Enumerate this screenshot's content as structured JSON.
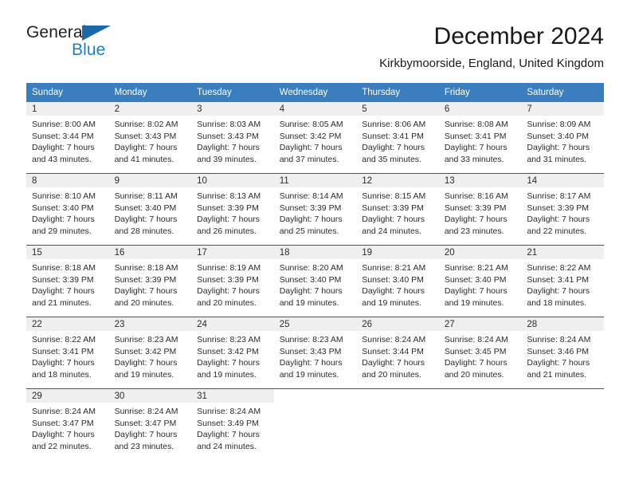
{
  "brand": {
    "name_part1": "General",
    "name_part2": "Blue",
    "flag_icon": "triangle-flag-icon"
  },
  "header": {
    "month_title": "December 2024",
    "location": "Kirkbymoorside, England, United Kingdom"
  },
  "colors": {
    "header_blue": "#3a7ebf",
    "separator_blue": "#1f5fa0",
    "daynum_band": "#efefef",
    "brand_blue": "#1f7ec4",
    "brand_flag": "#1769aa",
    "text": "#2b2b2b"
  },
  "weekday_headers": [
    "Sunday",
    "Monday",
    "Tuesday",
    "Wednesday",
    "Thursday",
    "Friday",
    "Saturday"
  ],
  "weeks": [
    [
      {
        "day": "1",
        "sunrise": "Sunrise: 8:00 AM",
        "sunset": "Sunset: 3:44 PM",
        "daylight_line1": "Daylight: 7 hours",
        "daylight_line2": "and 43 minutes."
      },
      {
        "day": "2",
        "sunrise": "Sunrise: 8:02 AM",
        "sunset": "Sunset: 3:43 PM",
        "daylight_line1": "Daylight: 7 hours",
        "daylight_line2": "and 41 minutes."
      },
      {
        "day": "3",
        "sunrise": "Sunrise: 8:03 AM",
        "sunset": "Sunset: 3:43 PM",
        "daylight_line1": "Daylight: 7 hours",
        "daylight_line2": "and 39 minutes."
      },
      {
        "day": "4",
        "sunrise": "Sunrise: 8:05 AM",
        "sunset": "Sunset: 3:42 PM",
        "daylight_line1": "Daylight: 7 hours",
        "daylight_line2": "and 37 minutes."
      },
      {
        "day": "5",
        "sunrise": "Sunrise: 8:06 AM",
        "sunset": "Sunset: 3:41 PM",
        "daylight_line1": "Daylight: 7 hours",
        "daylight_line2": "and 35 minutes."
      },
      {
        "day": "6",
        "sunrise": "Sunrise: 8:08 AM",
        "sunset": "Sunset: 3:41 PM",
        "daylight_line1": "Daylight: 7 hours",
        "daylight_line2": "and 33 minutes."
      },
      {
        "day": "7",
        "sunrise": "Sunrise: 8:09 AM",
        "sunset": "Sunset: 3:40 PM",
        "daylight_line1": "Daylight: 7 hours",
        "daylight_line2": "and 31 minutes."
      }
    ],
    [
      {
        "day": "8",
        "sunrise": "Sunrise: 8:10 AM",
        "sunset": "Sunset: 3:40 PM",
        "daylight_line1": "Daylight: 7 hours",
        "daylight_line2": "and 29 minutes."
      },
      {
        "day": "9",
        "sunrise": "Sunrise: 8:11 AM",
        "sunset": "Sunset: 3:40 PM",
        "daylight_line1": "Daylight: 7 hours",
        "daylight_line2": "and 28 minutes."
      },
      {
        "day": "10",
        "sunrise": "Sunrise: 8:13 AM",
        "sunset": "Sunset: 3:39 PM",
        "daylight_line1": "Daylight: 7 hours",
        "daylight_line2": "and 26 minutes."
      },
      {
        "day": "11",
        "sunrise": "Sunrise: 8:14 AM",
        "sunset": "Sunset: 3:39 PM",
        "daylight_line1": "Daylight: 7 hours",
        "daylight_line2": "and 25 minutes."
      },
      {
        "day": "12",
        "sunrise": "Sunrise: 8:15 AM",
        "sunset": "Sunset: 3:39 PM",
        "daylight_line1": "Daylight: 7 hours",
        "daylight_line2": "and 24 minutes."
      },
      {
        "day": "13",
        "sunrise": "Sunrise: 8:16 AM",
        "sunset": "Sunset: 3:39 PM",
        "daylight_line1": "Daylight: 7 hours",
        "daylight_line2": "and 23 minutes."
      },
      {
        "day": "14",
        "sunrise": "Sunrise: 8:17 AM",
        "sunset": "Sunset: 3:39 PM",
        "daylight_line1": "Daylight: 7 hours",
        "daylight_line2": "and 22 minutes."
      }
    ],
    [
      {
        "day": "15",
        "sunrise": "Sunrise: 8:18 AM",
        "sunset": "Sunset: 3:39 PM",
        "daylight_line1": "Daylight: 7 hours",
        "daylight_line2": "and 21 minutes."
      },
      {
        "day": "16",
        "sunrise": "Sunrise: 8:18 AM",
        "sunset": "Sunset: 3:39 PM",
        "daylight_line1": "Daylight: 7 hours",
        "daylight_line2": "and 20 minutes."
      },
      {
        "day": "17",
        "sunrise": "Sunrise: 8:19 AM",
        "sunset": "Sunset: 3:39 PM",
        "daylight_line1": "Daylight: 7 hours",
        "daylight_line2": "and 20 minutes."
      },
      {
        "day": "18",
        "sunrise": "Sunrise: 8:20 AM",
        "sunset": "Sunset: 3:40 PM",
        "daylight_line1": "Daylight: 7 hours",
        "daylight_line2": "and 19 minutes."
      },
      {
        "day": "19",
        "sunrise": "Sunrise: 8:21 AM",
        "sunset": "Sunset: 3:40 PM",
        "daylight_line1": "Daylight: 7 hours",
        "daylight_line2": "and 19 minutes."
      },
      {
        "day": "20",
        "sunrise": "Sunrise: 8:21 AM",
        "sunset": "Sunset: 3:40 PM",
        "daylight_line1": "Daylight: 7 hours",
        "daylight_line2": "and 19 minutes."
      },
      {
        "day": "21",
        "sunrise": "Sunrise: 8:22 AM",
        "sunset": "Sunset: 3:41 PM",
        "daylight_line1": "Daylight: 7 hours",
        "daylight_line2": "and 18 minutes."
      }
    ],
    [
      {
        "day": "22",
        "sunrise": "Sunrise: 8:22 AM",
        "sunset": "Sunset: 3:41 PM",
        "daylight_line1": "Daylight: 7 hours",
        "daylight_line2": "and 18 minutes."
      },
      {
        "day": "23",
        "sunrise": "Sunrise: 8:23 AM",
        "sunset": "Sunset: 3:42 PM",
        "daylight_line1": "Daylight: 7 hours",
        "daylight_line2": "and 19 minutes."
      },
      {
        "day": "24",
        "sunrise": "Sunrise: 8:23 AM",
        "sunset": "Sunset: 3:42 PM",
        "daylight_line1": "Daylight: 7 hours",
        "daylight_line2": "and 19 minutes."
      },
      {
        "day": "25",
        "sunrise": "Sunrise: 8:23 AM",
        "sunset": "Sunset: 3:43 PM",
        "daylight_line1": "Daylight: 7 hours",
        "daylight_line2": "and 19 minutes."
      },
      {
        "day": "26",
        "sunrise": "Sunrise: 8:24 AM",
        "sunset": "Sunset: 3:44 PM",
        "daylight_line1": "Daylight: 7 hours",
        "daylight_line2": "and 20 minutes."
      },
      {
        "day": "27",
        "sunrise": "Sunrise: 8:24 AM",
        "sunset": "Sunset: 3:45 PM",
        "daylight_line1": "Daylight: 7 hours",
        "daylight_line2": "and 20 minutes."
      },
      {
        "day": "28",
        "sunrise": "Sunrise: 8:24 AM",
        "sunset": "Sunset: 3:46 PM",
        "daylight_line1": "Daylight: 7 hours",
        "daylight_line2": "and 21 minutes."
      }
    ],
    [
      {
        "day": "29",
        "sunrise": "Sunrise: 8:24 AM",
        "sunset": "Sunset: 3:47 PM",
        "daylight_line1": "Daylight: 7 hours",
        "daylight_line2": "and 22 minutes."
      },
      {
        "day": "30",
        "sunrise": "Sunrise: 8:24 AM",
        "sunset": "Sunset: 3:47 PM",
        "daylight_line1": "Daylight: 7 hours",
        "daylight_line2": "and 23 minutes."
      },
      {
        "day": "31",
        "sunrise": "Sunrise: 8:24 AM",
        "sunset": "Sunset: 3:49 PM",
        "daylight_line1": "Daylight: 7 hours",
        "daylight_line2": "and 24 minutes."
      },
      {
        "day": "",
        "sunrise": "",
        "sunset": "",
        "daylight_line1": "",
        "daylight_line2": ""
      },
      {
        "day": "",
        "sunrise": "",
        "sunset": "",
        "daylight_line1": "",
        "daylight_line2": ""
      },
      {
        "day": "",
        "sunrise": "",
        "sunset": "",
        "daylight_line1": "",
        "daylight_line2": ""
      },
      {
        "day": "",
        "sunrise": "",
        "sunset": "",
        "daylight_line1": "",
        "daylight_line2": ""
      }
    ]
  ]
}
